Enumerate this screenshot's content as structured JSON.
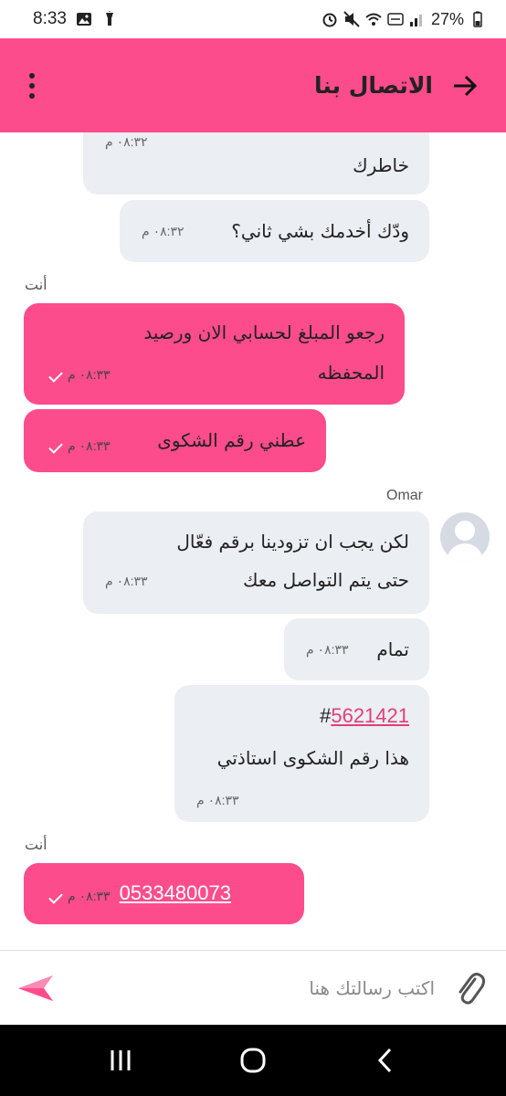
{
  "status": {
    "time": "8:33",
    "battery": "27%",
    "icons": [
      "image-icon",
      "flashlight-icon",
      "alarm-icon",
      "mute-icon",
      "wifi-icon",
      "volte-icon",
      "signal-icon",
      "battery-icon"
    ]
  },
  "header": {
    "title": "الاتصال بنا",
    "back_icon": "arrow-right-icon",
    "menu_icon": "kebab-menu-icon"
  },
  "messages": [
    {
      "id": "m1",
      "from": "agent",
      "text_lines": [
        "خاطرك"
      ],
      "time": "٠٨:٣٢ م"
    },
    {
      "id": "m2",
      "from": "agent",
      "text_lines": [
        "ودّك أخدمك بشي ثاني؟"
      ],
      "time": "٠٨:٣٢ م"
    },
    {
      "id": "s1",
      "sender_label": "أنت"
    },
    {
      "id": "m3",
      "from": "user",
      "text_lines": [
        "رجعو المبلغ لحسابي الان ورصيد",
        "المحفظه"
      ],
      "time": "٠٨:٣٣ م"
    },
    {
      "id": "m4",
      "from": "user",
      "text_lines": [
        "عطني رقم الشكوى"
      ],
      "time": "٠٨:٣٣ م"
    },
    {
      "id": "s2",
      "sender_label": "Omar"
    },
    {
      "id": "m5",
      "from": "agent",
      "text_lines": [
        "لكن يجب ان تزودينا برقم فعّال",
        "حتى يتم التواصل معك"
      ],
      "time": "٠٨:٣٣ م"
    },
    {
      "id": "m6",
      "from": "agent",
      "text_lines": [
        "تمام"
      ],
      "time": "٠٨:٣٣ م"
    },
    {
      "id": "m7",
      "from": "agent",
      "hash": "#",
      "link": "5621421",
      "text_lines": [
        "هذا رقم الشكوى استاذتي"
      ],
      "time": "٠٨:٣٣ م"
    },
    {
      "id": "s3",
      "sender_label": "أنت"
    },
    {
      "id": "m8",
      "from": "user",
      "link": "0533480073",
      "time": "٠٨:٣٣ م"
    }
  ],
  "composer": {
    "placeholder": "اكتب رسالتك هنا",
    "send_icon": "send-icon",
    "attach_icon": "paperclip-icon"
  },
  "navbar": {
    "icons": [
      "recent-apps-icon",
      "home-icon",
      "back-icon"
    ]
  },
  "colors": {
    "accent": "#fd4c8b",
    "incoming_bubble": "#ebeef2",
    "link": "#e0407a"
  }
}
